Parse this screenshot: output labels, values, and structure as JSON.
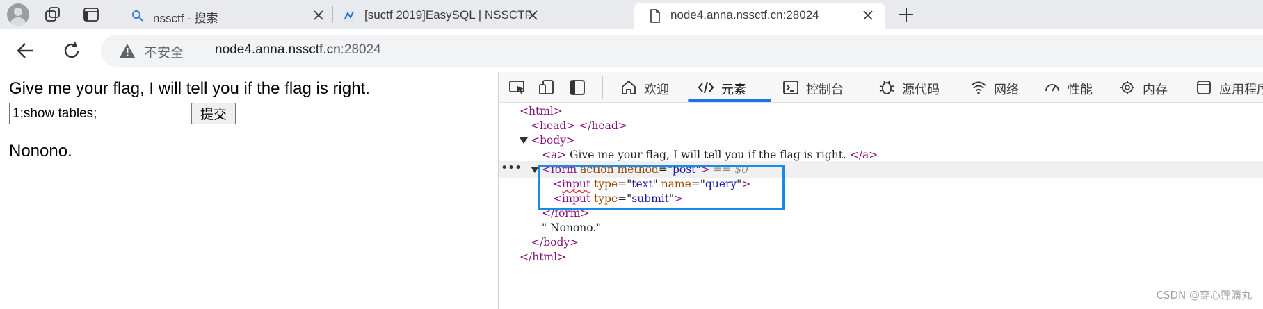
{
  "browser": {
    "tabs": [
      {
        "title": "nssctf - 搜索",
        "icon": "search-icon"
      },
      {
        "title": "[suctf 2019]EasySQL | NSSCTF",
        "icon": "site-favicon"
      },
      {
        "title": "node4.anna.nssctf.cn:28024",
        "icon": "page-icon"
      }
    ],
    "new_tab_label": "+",
    "address": {
      "insecure_label": "不安全",
      "host": "node4.anna.nssctf.cn",
      "port": ":28024"
    }
  },
  "page": {
    "prompt_text": "Give me your flag, I will tell you if the flag is right.",
    "input_value": "1;show tables;",
    "submit_label": "提交",
    "result_text": "Nonono."
  },
  "devtools": {
    "tabs": [
      {
        "label": "欢迎",
        "icon": "home-icon"
      },
      {
        "label": "元素",
        "icon": "code-icon"
      },
      {
        "label": "控制台",
        "icon": "console-icon"
      },
      {
        "label": "源代码",
        "icon": "bug-icon"
      },
      {
        "label": "网络",
        "icon": "wifi-icon"
      },
      {
        "label": "性能",
        "icon": "gauge-icon"
      },
      {
        "label": "内存",
        "icon": "chip-icon"
      },
      {
        "label": "应用程序",
        "icon": "app-icon"
      }
    ],
    "active_tab": "元素",
    "dom": {
      "html_open": "<html>",
      "head_open": "<head>",
      "head_close": "</head>",
      "body_open": "<body>",
      "a_open": "<a>",
      "a_text": " Give me your flag, I will tell you if the flag is right. ",
      "a_close": "</a>",
      "form_tag": "form",
      "form_attr1_name": "action",
      "form_attr2_name": "method",
      "form_attr2_value": "post",
      "selected_marker": "== $0",
      "input1_tag": "input",
      "input1_attr1_name": "type",
      "input1_attr1_value": "text",
      "input1_attr2_name": "name",
      "input1_attr2_value": "query",
      "input2_tag": "input",
      "input2_attr1_name": "type",
      "input2_attr1_value": "submit",
      "form_close": "</form>",
      "text_node": "\" Nonono.\"",
      "body_close": "</body>",
      "html_close": "</html>",
      "ellipsis": "•••"
    }
  },
  "watermark": "CSDN @穿心莲滴丸",
  "colors": {
    "highlight": "#1a8ae8",
    "active_tab_underline": "#1a73e8",
    "tag": "#881280",
    "attr_name": "#994500",
    "attr_value": "#1a1aa6"
  }
}
